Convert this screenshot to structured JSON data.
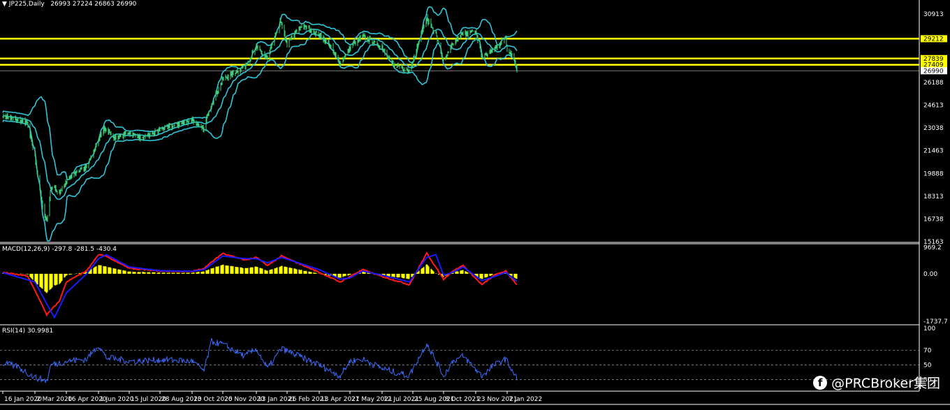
{
  "header": {
    "symbol": "JP225,Daily",
    "ohlc": "26993 27224 26863 26990"
  },
  "macd_label": "MACD(12,26,9) -297.8 -281.5 -430.4",
  "rsi_label": "RSI(14) 30.9981",
  "watermark": "@PRCBroker集团",
  "colors": {
    "background": "#000000",
    "candles": "#3fcf7a",
    "bands": "#2fc4d8",
    "levels": "#ffff00",
    "macd_hist": "#ffff00",
    "macd_line": "#ff1a1a",
    "macd_signal": "#1a1aff",
    "rsi": "#3a6cff"
  },
  "chart_data": [
    {
      "type": "candlestick",
      "name": "JP225 Daily price",
      "y_ticks": [
        "30913",
        "29212",
        "27839",
        "27409",
        "26990",
        "26188",
        "24613",
        "23038",
        "21463",
        "19888",
        "18313",
        "16738",
        "15163"
      ],
      "ylim": [
        15163,
        31600
      ],
      "levels": [
        29212,
        27839,
        27409
      ],
      "current": 26990,
      "x_ticks": [
        "16 Jan 2020",
        "2 Mar 2020",
        "16 Apr 2020",
        "1 Jun 2020",
        "15 Jul 2020",
        "28 Aug 2020",
        "13 Oct 2020",
        "26 Nov 2020",
        "13 Jan 2021",
        "26 Feb 2021",
        "13 Apr 2021",
        "27 May 2021",
        "12 Jul 2021",
        "25 Aug 2021",
        "8 Oct 2021",
        "23 Nov 2021",
        "7 Jan 2022"
      ],
      "close_knots": [
        [
          "16 Jan 2020",
          23900
        ],
        [
          "5 Feb 2020",
          23600
        ],
        [
          "20 Feb 2020",
          23400
        ],
        [
          "2 Mar 2020",
          21000
        ],
        [
          "13 Mar 2020",
          17500
        ],
        [
          "19 Mar 2020",
          16550
        ],
        [
          "25 Mar 2020",
          19000
        ],
        [
          "6 Apr 2020",
          18600
        ],
        [
          "16 Apr 2020",
          19300
        ],
        [
          "30 Apr 2020",
          20000
        ],
        [
          "15 May 2020",
          20400
        ],
        [
          "1 Jun 2020",
          22100
        ],
        [
          "9 Jun 2020",
          23100
        ],
        [
          "25 Jun 2020",
          22300
        ],
        [
          "15 Jul 2020",
          22700
        ],
        [
          "3 Aug 2020",
          22300
        ],
        [
          "28 Aug 2020",
          22900
        ],
        [
          "13 Oct 2020",
          23600
        ],
        [
          "30 Oct 2020",
          22900
        ],
        [
          "6 Nov 2020",
          24300
        ],
        [
          "26 Nov 2020",
          26400
        ],
        [
          "28 Dec 2020",
          27300
        ],
        [
          "13 Jan 2021",
          28600
        ],
        [
          "29 Jan 2021",
          27800
        ],
        [
          "16 Feb 2021",
          30400
        ],
        [
          "26 Feb 2021",
          28900
        ],
        [
          "18 Mar 2021",
          30100
        ],
        [
          "13 Apr 2021",
          29500
        ],
        [
          "27 Apr 2021",
          28800
        ],
        [
          "13 May 2021",
          27500
        ],
        [
          "27 May 2021",
          28600
        ],
        [
          "14 Jun 2021",
          29400
        ],
        [
          "12 Jul 2021",
          28600
        ],
        [
          "30 Jul 2021",
          27300
        ],
        [
          "20 Aug 2021",
          27000
        ],
        [
          "25 Aug 2021",
          27700
        ],
        [
          "6 Sep 2021",
          29600
        ],
        [
          "14 Sep 2021",
          30600
        ],
        [
          "27 Sep 2021",
          29500
        ],
        [
          "8 Oct 2021",
          27600
        ],
        [
          "21 Oct 2021",
          28800
        ],
        [
          "5 Nov 2021",
          29600
        ],
        [
          "23 Nov 2021",
          29700
        ],
        [
          "2 Dec 2021",
          27900
        ],
        [
          "20 Dec 2021",
          28500
        ],
        [
          "5 Jan 2022",
          29300
        ],
        [
          "7 Jan 2022",
          28500
        ],
        [
          "14 Jan 2022",
          28100
        ],
        [
          "19 Jan 2022",
          27500
        ],
        [
          "21 Jan 2022",
          26990
        ]
      ]
    },
    {
      "type": "macd",
      "name": "MACD(12,26,9)",
      "y_ticks": [
        "969.2",
        "0.00",
        "-1737.7"
      ],
      "ylim": [
        -1737.7,
        969.2
      ],
      "macd_knots": [
        [
          "16 Jan 2020",
          50
        ],
        [
          "20 Feb 2020",
          -80
        ],
        [
          "2 Mar 2020",
          -600
        ],
        [
          "19 Mar 2020",
          -1500
        ],
        [
          "6 Apr 2020",
          -1000
        ],
        [
          "16 Apr 2020",
          -300
        ],
        [
          "15 May 2020",
          100
        ],
        [
          "1 Jun 2020",
          700
        ],
        [
          "12 Jun 2020",
          650
        ],
        [
          "15 Jul 2020",
          200
        ],
        [
          "28 Aug 2020",
          100
        ],
        [
          "13 Oct 2020",
          80
        ],
        [
          "30 Oct 2020",
          200
        ],
        [
          "26 Nov 2020",
          750
        ],
        [
          "28 Dec 2020",
          500
        ],
        [
          "13 Jan 2021",
          600
        ],
        [
          "29 Jan 2021",
          300
        ],
        [
          "18 Feb 2021",
          650
        ],
        [
          "13 Apr 2021",
          50
        ],
        [
          "13 May 2021",
          -300
        ],
        [
          "27 May 2021",
          -100
        ],
        [
          "14 Jun 2021",
          150
        ],
        [
          "12 Jul 2021",
          -100
        ],
        [
          "20 Aug 2021",
          -400
        ],
        [
          "14 Sep 2021",
          750
        ],
        [
          "8 Oct 2021",
          -200
        ],
        [
          "21 Oct 2021",
          100
        ],
        [
          "5 Nov 2021",
          300
        ],
        [
          "2 Dec 2021",
          -400
        ],
        [
          "20 Dec 2021",
          -50
        ],
        [
          "5 Jan 2022",
          100
        ],
        [
          "21 Jan 2022",
          -400
        ]
      ],
      "signal_knots": [
        [
          "16 Jan 2020",
          40
        ],
        [
          "2 Mar 2020",
          -300
        ],
        [
          "19 Mar 2020",
          -1100
        ],
        [
          "30 Mar 2020",
          -1600
        ],
        [
          "16 Apr 2020",
          -700
        ],
        [
          "15 May 2020",
          0
        ],
        [
          "1 Jun 2020",
          550
        ],
        [
          "12 Jun 2020",
          700
        ],
        [
          "15 Jul 2020",
          250
        ],
        [
          "28 Aug 2020",
          110
        ],
        [
          "13 Oct 2020",
          90
        ],
        [
          "30 Oct 2020",
          150
        ],
        [
          "26 Nov 2020",
          650
        ],
        [
          "28 Dec 2020",
          550
        ],
        [
          "13 Jan 2021",
          550
        ],
        [
          "29 Jan 2021",
          400
        ],
        [
          "18 Feb 2021",
          600
        ],
        [
          "13 Apr 2021",
          150
        ],
        [
          "13 May 2021",
          -200
        ],
        [
          "27 May 2021",
          -150
        ],
        [
          "14 Jun 2021",
          100
        ],
        [
          "12 Jul 2021",
          -50
        ],
        [
          "20 Aug 2021",
          -300
        ],
        [
          "14 Sep 2021",
          600
        ],
        [
          "27 Sep 2021",
          700
        ],
        [
          "8 Oct 2021",
          -50
        ],
        [
          "21 Oct 2021",
          50
        ],
        [
          "5 Nov 2021",
          250
        ],
        [
          "2 Dec 2021",
          -250
        ],
        [
          "20 Dec 2021",
          -100
        ],
        [
          "5 Jan 2022",
          50
        ],
        [
          "21 Jan 2022",
          -280
        ]
      ]
    },
    {
      "type": "line",
      "name": "RSI(14)",
      "y_ticks": [
        "100",
        "70",
        "50",
        "30"
      ],
      "ylim": [
        18,
        100
      ],
      "levels": [
        70,
        50,
        30
      ],
      "knots": [
        [
          "16 Jan 2020",
          52
        ],
        [
          "5 Feb 2020",
          48
        ],
        [
          "2 Mar 2020",
          33
        ],
        [
          "19 Mar 2020",
          28
        ],
        [
          "25 Mar 2020",
          50
        ],
        [
          "16 Apr 2020",
          55
        ],
        [
          "15 May 2020",
          58
        ],
        [
          "1 Jun 2020",
          77
        ],
        [
          "12 Jun 2020",
          60
        ],
        [
          "15 Jul 2020",
          55
        ],
        [
          "28 Aug 2020",
          57
        ],
        [
          "13 Oct 2020",
          55
        ],
        [
          "30 Oct 2020",
          42
        ],
        [
          "10 Nov 2020",
          82
        ],
        [
          "26 Nov 2020",
          78
        ],
        [
          "28 Dec 2020",
          62
        ],
        [
          "13 Jan 2021",
          72
        ],
        [
          "29 Jan 2021",
          45
        ],
        [
          "18 Feb 2021",
          72
        ],
        [
          "13 Apr 2021",
          50
        ],
        [
          "13 May 2021",
          35
        ],
        [
          "27 May 2021",
          55
        ],
        [
          "14 Jun 2021",
          58
        ],
        [
          "12 Jul 2021",
          45
        ],
        [
          "20 Aug 2021",
          35
        ],
        [
          "14 Sep 2021",
          80
        ],
        [
          "8 Oct 2021",
          35
        ],
        [
          "21 Oct 2021",
          55
        ],
        [
          "5 Nov 2021",
          62
        ],
        [
          "2 Dec 2021",
          35
        ],
        [
          "20 Dec 2021",
          50
        ],
        [
          "5 Jan 2022",
          58
        ],
        [
          "21 Jan 2022",
          31
        ]
      ]
    }
  ]
}
